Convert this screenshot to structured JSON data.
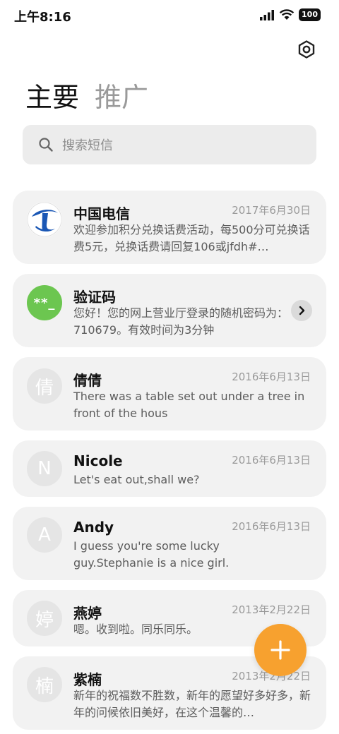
{
  "status": {
    "time": "上午8:16",
    "battery": "100"
  },
  "tabs": [
    {
      "label": "主要"
    },
    {
      "label": "推广"
    }
  ],
  "search": {
    "placeholder": "搜索短信"
  },
  "conversations": [
    {
      "name": "中国电信",
      "date": "2017年6月30日",
      "preview": "欢迎参加积分兑换话费活动，每500分可兑换话费5元，兑换话费请回复106或jfdh#…",
      "avatar": "telecom-logo"
    },
    {
      "name": "验证码",
      "date": "",
      "preview": "您好！您的网上营业厅登录的随机密码为：710679。有效时间为3分钟",
      "avatar": "**_"
    },
    {
      "name": "倩倩",
      "date": "2016年6月13日",
      "preview": "There was a table set out under a tree in front of the hous",
      "avatar": "倩"
    },
    {
      "name": "Nicole",
      "date": "2016年6月13日",
      "preview": "Let's eat out,shall we?",
      "avatar": "N"
    },
    {
      "name": "Andy",
      "date": "2016年6月13日",
      "preview": "I guess you're some lucky guy.Stephanie is a nice girl.",
      "avatar": "A"
    },
    {
      "name": "燕婷",
      "date": "2013年2月22日",
      "preview": "嗯。收到啦。同乐同乐。",
      "avatar": "婷"
    },
    {
      "name": "紫楠",
      "date": "2013年2月22日",
      "preview": "新年的祝福数不胜数，新年的愿望好多好多，新年的问候依旧美好，在这个温馨的…",
      "avatar": "楠"
    }
  ],
  "colors": {
    "accent": "#f7a12f",
    "verification_avatar": "#6cc650",
    "telecom_blue": "#1a57b5"
  },
  "icons": {
    "settings": "gear-icon",
    "search": "search-icon",
    "fab": "plus-icon",
    "chevron": "chevron-right-icon"
  }
}
